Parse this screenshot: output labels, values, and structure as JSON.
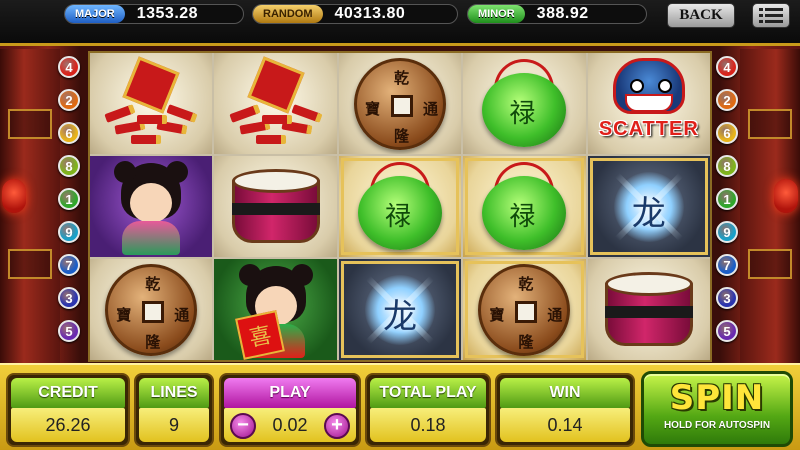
{
  "jackpots": {
    "major": {
      "label": "MAJOR",
      "value": "1353.28"
    },
    "random": {
      "label": "RANDOM",
      "value": "40313.80"
    },
    "minor": {
      "label": "MINOR",
      "value": "388.92"
    }
  },
  "nav": {
    "back_label": "BACK",
    "menu_icon": "menu-icon"
  },
  "paylines": {
    "left": [
      {
        "num": "4",
        "color": "#d9241c"
      },
      {
        "num": "2",
        "color": "#e06a12"
      },
      {
        "num": "6",
        "color": "#e8b41a"
      },
      {
        "num": "8",
        "color": "#7fb51c"
      },
      {
        "num": "1",
        "color": "#2fa82a"
      },
      {
        "num": "9",
        "color": "#19a0c8"
      },
      {
        "num": "7",
        "color": "#1a5ec8"
      },
      {
        "num": "3",
        "color": "#2a35b0"
      },
      {
        "num": "5",
        "color": "#6a2ab0"
      }
    ],
    "right": [
      {
        "num": "4",
        "color": "#d9241c"
      },
      {
        "num": "2",
        "color": "#e06a12"
      },
      {
        "num": "6",
        "color": "#e8b41a"
      },
      {
        "num": "8",
        "color": "#7fb51c"
      },
      {
        "num": "1",
        "color": "#2fa82a"
      },
      {
        "num": "9",
        "color": "#19a0c8"
      },
      {
        "num": "7",
        "color": "#1a5ec8"
      },
      {
        "num": "3",
        "color": "#2a35b0"
      },
      {
        "num": "5",
        "color": "#6a2ab0"
      }
    ]
  },
  "reels": [
    [
      "firecracker",
      "firecracker",
      "coin",
      "jade",
      "lion-scatter"
    ],
    [
      "girl",
      "drum",
      "jade",
      "jade",
      "wild"
    ],
    [
      "coin",
      "boy",
      "wild",
      "coin",
      "drum"
    ]
  ],
  "highlighted": [
    [
      1,
      2
    ],
    [
      1,
      3
    ],
    [
      1,
      4
    ],
    [
      2,
      2
    ],
    [
      2,
      3
    ]
  ],
  "symbols": {
    "scatter_text": "SCATTER",
    "coin_chars": [
      "乾",
      "寶",
      "通",
      "隆"
    ],
    "boy_sign": "喜",
    "wild_glyph": "龙"
  },
  "panels": {
    "credit": {
      "label": "CREDIT",
      "value": "26.26"
    },
    "lines": {
      "label": "LINES",
      "value": "9"
    },
    "play": {
      "label": "PLAY",
      "value": "0.02",
      "minus": "−",
      "plus": "+"
    },
    "total_play": {
      "label": "TOTAL PLAY",
      "value": "0.18"
    },
    "win": {
      "label": "WIN",
      "value": "0.14"
    }
  },
  "spin": {
    "label": "SPIN",
    "sublabel": "HOLD FOR AUTOSPIN"
  },
  "colors": {
    "gold": "#e8c04a",
    "green": "#4f9a14",
    "magenta": "#b0159f"
  }
}
